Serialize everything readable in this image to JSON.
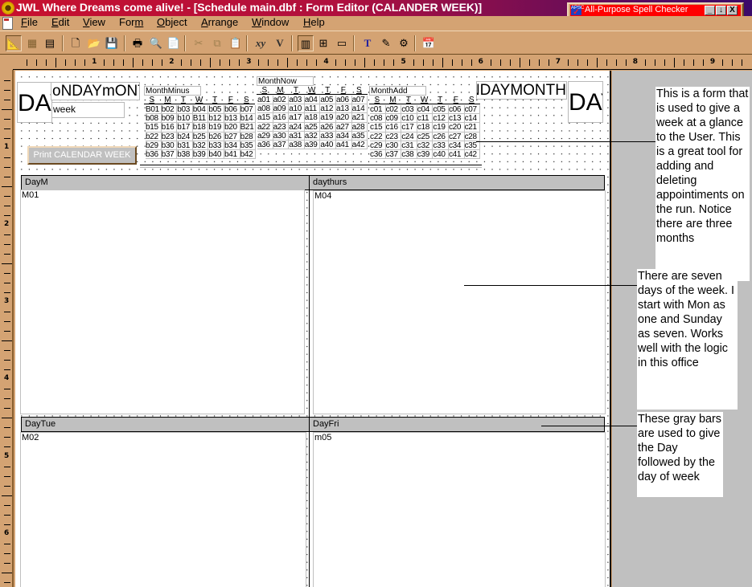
{
  "window": {
    "title": "JWL Where Dreams come alive! - [Schedule main.dbf : Form Editor (CALANDER WEEK)]"
  },
  "spell_checker": {
    "title": "All-Purpose Spell Checker",
    "icon_text": "APSC",
    "buttons": [
      "_",
      "↓",
      "X"
    ]
  },
  "menu": {
    "items": [
      {
        "label": "File",
        "accel": "F"
      },
      {
        "label": "Edit",
        "accel": "E"
      },
      {
        "label": "View",
        "accel": "V"
      },
      {
        "label": "Form",
        "accel": "m"
      },
      {
        "label": "Object",
        "accel": "O"
      },
      {
        "label": "Arrange",
        "accel": "A"
      },
      {
        "label": "Window",
        "accel": "W"
      },
      {
        "label": "Help",
        "accel": "H"
      }
    ]
  },
  "toolbar": {
    "buttons": [
      {
        "name": "design-mode",
        "glyph": "📐",
        "pressed": true
      },
      {
        "name": "browse-table",
        "glyph": "▦"
      },
      {
        "name": "form-view",
        "glyph": "▤"
      },
      {
        "name": "new-file",
        "glyph": "🗋"
      },
      {
        "name": "open-file",
        "glyph": "📂"
      },
      {
        "name": "save",
        "glyph": "💾"
      },
      {
        "name": "print",
        "glyph": "🖶"
      },
      {
        "name": "print-preview",
        "glyph": "🔍"
      },
      {
        "name": "page-setup",
        "glyph": "📄"
      },
      {
        "name": "cut",
        "glyph": "✂"
      },
      {
        "name": "copy",
        "glyph": "⧉"
      },
      {
        "name": "paste",
        "glyph": "📋"
      },
      {
        "name": "expression",
        "glyph": "xy"
      },
      {
        "name": "filter",
        "glyph": "V"
      },
      {
        "name": "layout-view",
        "glyph": "▥",
        "pressed": true
      },
      {
        "name": "grid-view",
        "glyph": "⊞"
      },
      {
        "name": "window-view",
        "glyph": "▭"
      },
      {
        "name": "text-tool",
        "glyph": "T"
      },
      {
        "name": "edit-field",
        "glyph": "✎"
      },
      {
        "name": "properties",
        "glyph": "⚙"
      },
      {
        "name": "calendar",
        "glyph": "📅"
      }
    ]
  },
  "ruler": {
    "h_numbers": [
      "1",
      "2",
      "3",
      "4",
      "5",
      "6",
      "7",
      "8",
      "9"
    ],
    "v_numbers": [
      "1",
      "2",
      "3",
      "4",
      "5",
      "6"
    ]
  },
  "form": {
    "day_left": "DAY",
    "day_right": "DAY",
    "month_title_left": "oNDAYmONTH",
    "month_title_right": "NDAYMONTH",
    "week_field": "week",
    "print_button": "Print CALENDAR WEEK",
    "dow_headers": [
      "S",
      "M",
      "T",
      "W",
      "T",
      "F",
      "S"
    ],
    "months": [
      {
        "label": "MonthMinus",
        "cells": [
          "B01",
          "b02",
          "b03",
          "b04",
          "b05",
          "b06",
          "b07",
          "b08",
          "b09",
          "b10",
          "B11",
          "b12",
          "b13",
          "b14",
          "b15",
          "b16",
          "b17",
          "b18",
          "b19",
          "b20",
          "B21",
          "b22",
          "b23",
          "b24",
          "b25",
          "b26",
          "b27",
          "b28",
          "b29",
          "b30",
          "b31",
          "b32",
          "b33",
          "b34",
          "b35",
          "b36",
          "b37",
          "b38",
          "b39",
          "b40",
          "b41",
          "b42"
        ]
      },
      {
        "label": "MonthNow",
        "cells": [
          "a01",
          "a02",
          "a03",
          "a04",
          "a05",
          "a06",
          "a07",
          "a08",
          "a09",
          "a10",
          "a11",
          "a12",
          "a13",
          "a14",
          "a15",
          "a16",
          "a17",
          "a18",
          "a19",
          "a20",
          "a21",
          "a22",
          "a23",
          "a24",
          "a25",
          "a26",
          "a27",
          "a28",
          "a29",
          "a30",
          "a31",
          "a32",
          "a33",
          "a34",
          "a35",
          "a36",
          "a37",
          "a38",
          "a39",
          "a40",
          "a41",
          "a42"
        ]
      },
      {
        "label": "MonthAdd",
        "cells": [
          "c01",
          "c02",
          "c03",
          "c04",
          "c05",
          "c06",
          "c07",
          "c08",
          "c09",
          "c10",
          "c11",
          "c12",
          "c13",
          "c14",
          "c15",
          "c16",
          "c17",
          "c18",
          "c19",
          "c20",
          "c21",
          "c22",
          "c23",
          "c24",
          "c25",
          "c26",
          "c27",
          "c28",
          "c29",
          "c30",
          "c31",
          "c32",
          "c33",
          "c34",
          "c35",
          "c36",
          "c37",
          "c38",
          "c39",
          "c40",
          "c41",
          "c42"
        ]
      }
    ],
    "days": [
      {
        "header": "DayM",
        "field": "M01"
      },
      {
        "header": "daythurs",
        "field": "M04"
      },
      {
        "header": "DayTue",
        "field": "M02"
      },
      {
        "header": "DayFri",
        "field": "m05"
      }
    ]
  },
  "notes": [
    "This is a form that is used to give a week at a glance to the User.  This is a great tool for adding and deleting appointiments on the run. Notice there are three months",
    "There are seven days of the week. I start with Mon as one and Sunday as seven.  Works well with the logic in this office",
    "These gray bars are used to give the Day followed by the day of week"
  ]
}
